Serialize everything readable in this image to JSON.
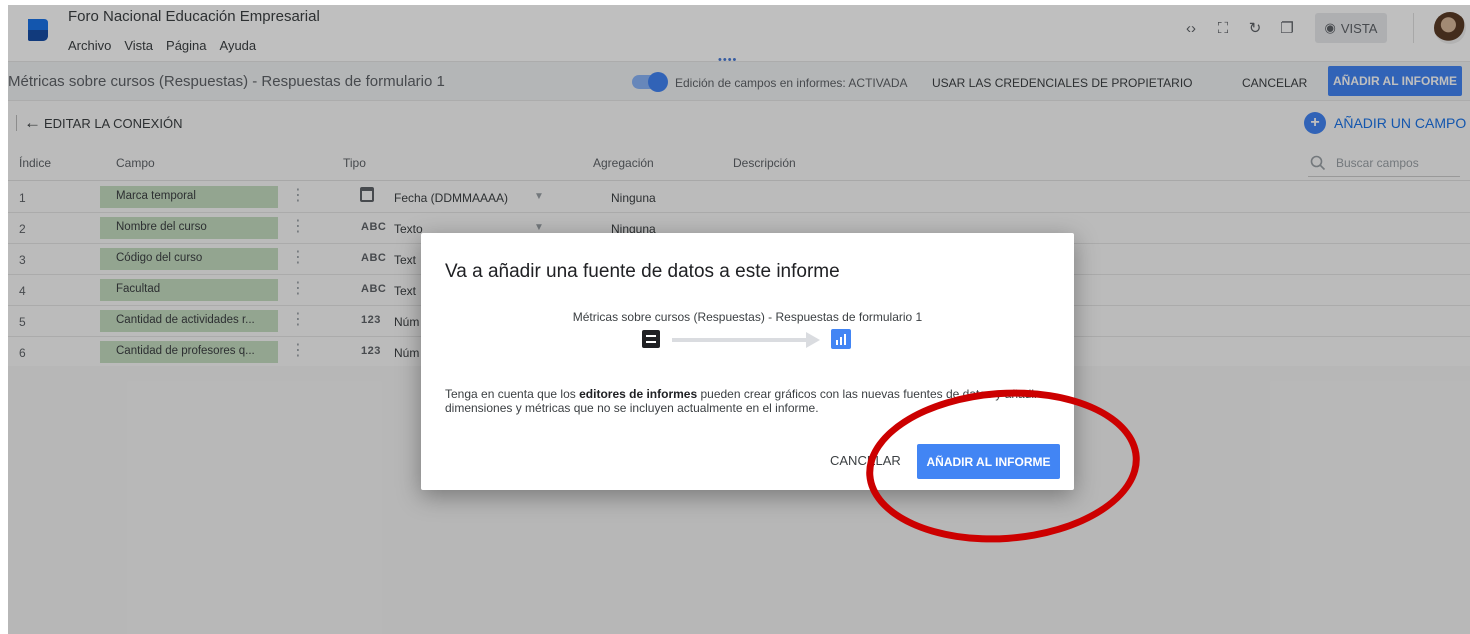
{
  "app": {
    "title": "Foro Nacional Educación Empresarial",
    "menu": [
      "Archivo",
      "Vista",
      "Página",
      "Ayuda"
    ],
    "view_button": "VISTA",
    "icons": [
      "code-icon",
      "fullscreen-icon",
      "refresh-icon",
      "copy-icon",
      "eye-icon"
    ]
  },
  "connection": {
    "title": "Métricas sobre cursos (Respuestas) - Respuestas de formulario 1",
    "field_editing_label": "Edición de campos en informes: ACTIVADA",
    "field_editing_on": true,
    "owner_credentials": "USAR LAS CREDENCIALES DE PROPIETARIO",
    "cancel": "CANCELAR",
    "add_to_report": "AÑADIR AL INFORME"
  },
  "edit": {
    "back_label": "EDITAR LA CONEXIÓN",
    "add_field": "AÑADIR UN CAMPO"
  },
  "table": {
    "headers": {
      "index": "Índice",
      "field": "Campo",
      "type": "Tipo",
      "aggregation": "Agregación",
      "description": "Descripción"
    },
    "search_placeholder": "Buscar campos",
    "rows": [
      {
        "index": "1",
        "field": "Marca temporal",
        "type_icon": "calendar-icon",
        "type": "Fecha (DDMMAAAA)",
        "aggregation": "Ninguna"
      },
      {
        "index": "2",
        "field": "Nombre del curso",
        "type_icon": "ABC",
        "type": "Texto",
        "aggregation": "Ninguna"
      },
      {
        "index": "3",
        "field": "Código del curso",
        "type_icon": "ABC",
        "type": "Text",
        "aggregation": ""
      },
      {
        "index": "4",
        "field": "Facultad",
        "type_icon": "ABC",
        "type": "Text",
        "aggregation": ""
      },
      {
        "index": "5",
        "field": "Cantidad de actividades r...",
        "type_icon": "123",
        "type": "Núm",
        "aggregation": ""
      },
      {
        "index": "6",
        "field": "Cantidad de profesores q...",
        "type_icon": "123",
        "type": "Núm",
        "aggregation": ""
      }
    ]
  },
  "dialog": {
    "title": "Va a añadir una fuente de datos a este informe",
    "source": "Métricas sobre cursos (Respuestas) - Respuestas de formulario 1",
    "note_prefix": "Tenga en cuenta que los ",
    "note_bold": "editores de informes",
    "note_suffix": " pueden crear gráficos con las nuevas fuentes de datos y añadir dimensiones y métricas que no se incluyen actualmente en el informe.",
    "cancel": "CANCELAR",
    "add": "AÑADIR AL INFORME"
  },
  "colors": {
    "accent": "#4285f4",
    "field_chip": "#c5dcc0",
    "annotation": "#cc0000"
  }
}
